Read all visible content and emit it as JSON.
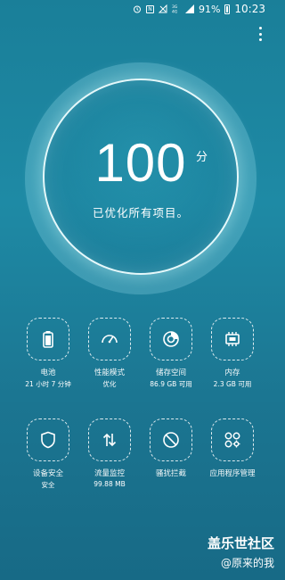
{
  "status_bar": {
    "battery_percent": "91%",
    "time": "10:23",
    "icons": [
      "alarm-icon",
      "n-icon",
      "no-signal-icon",
      "4g-icon",
      "signal-icon",
      "battery-icon"
    ]
  },
  "score": {
    "value": "100",
    "unit": "分",
    "description": "已优化所有项目。"
  },
  "tiles": [
    {
      "label": "电池",
      "sub": "21 小时 7 分钟",
      "icon": "battery-icon"
    },
    {
      "label": "性能模式",
      "sub": "优化",
      "icon": "speedometer-icon"
    },
    {
      "label": "储存空间",
      "sub": "86.9 GB 可用",
      "icon": "storage-icon"
    },
    {
      "label": "内存",
      "sub": "2.3 GB 可用",
      "icon": "memory-chip-icon"
    },
    {
      "label": "设备安全",
      "sub": "安全",
      "icon": "shield-icon"
    },
    {
      "label": "流量监控",
      "sub": "99.88 MB",
      "icon": "data-arrows-icon"
    },
    {
      "label": "骚扰拦截",
      "sub": "",
      "icon": "block-icon"
    },
    {
      "label": "应用程序管理",
      "sub": "",
      "icon": "apps-icon"
    }
  ],
  "watermark": {
    "site": "盖乐世社区",
    "user": "@原来的我"
  }
}
